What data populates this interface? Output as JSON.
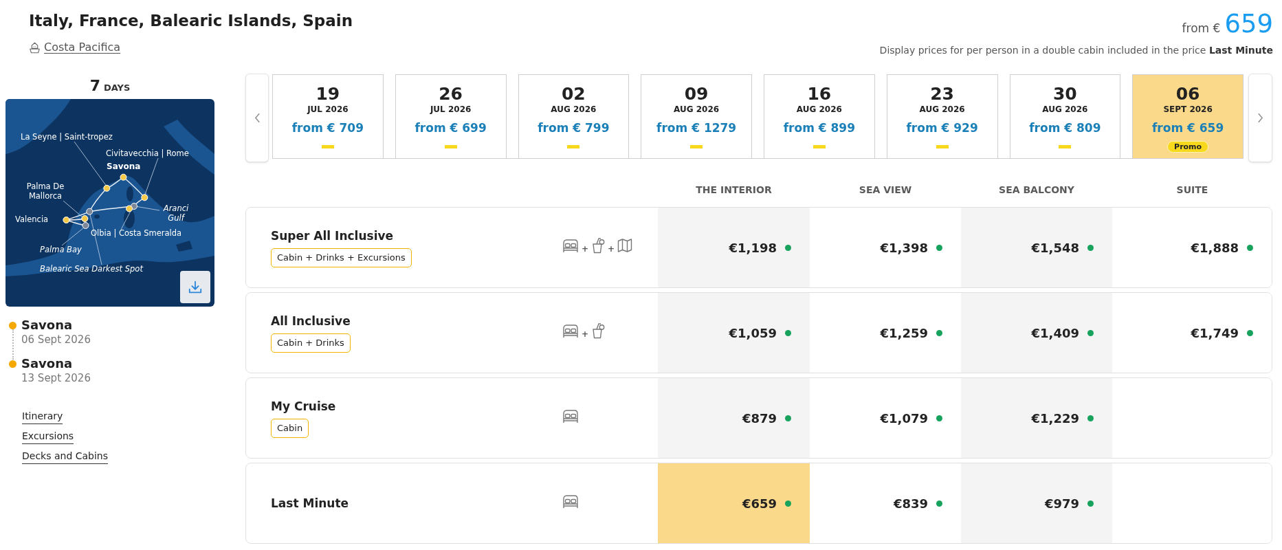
{
  "header": {
    "title": "Italy, France, Balearic Islands, Spain",
    "ship": "Costa Pacifica",
    "price": {
      "prefix": "from €",
      "amount": "659"
    },
    "note": "Display prices for per person in a double cabin included in the price **Last Minute**"
  },
  "duration": {
    "number": "7",
    "unit": "DAYS"
  },
  "map": {
    "labels": [
      {
        "text": "La Seyne | Saint-tropez",
        "kind": "port"
      },
      {
        "text": "Civitavecchia | Rome",
        "kind": "port"
      },
      {
        "text": "Savona",
        "kind": "home"
      },
      {
        "text": "Palma De Mallorca",
        "kind": "port"
      },
      {
        "text": "Valencia",
        "kind": "port"
      },
      {
        "text": "Aranci Gulf",
        "kind": "sea"
      },
      {
        "text": "Olbia | Costa Smeralda",
        "kind": "port"
      },
      {
        "text": "Palma Bay",
        "kind": "sea"
      },
      {
        "text": "Balearic Sea Darkest Spot",
        "kind": "sea"
      }
    ]
  },
  "itinerary": [
    {
      "port": "Savona",
      "date": "06 Sept 2026"
    },
    {
      "port": "Savona",
      "date": "13 Sept 2026"
    }
  ],
  "links": [
    "Itinerary",
    "Excursions",
    "Decks and Cabins"
  ],
  "dates": [
    {
      "day": "19",
      "month": "JUL 2026",
      "price": "from € 709",
      "selected": false
    },
    {
      "day": "26",
      "month": "JUL 2026",
      "price": "from € 699",
      "selected": false
    },
    {
      "day": "02",
      "month": "AUG 2026",
      "price": "from € 799",
      "selected": false
    },
    {
      "day": "09",
      "month": "AUG 2026",
      "price": "from € 1279",
      "selected": false
    },
    {
      "day": "16",
      "month": "AUG 2026",
      "price": "from € 899",
      "selected": false
    },
    {
      "day": "23",
      "month": "AUG 2026",
      "price": "from € 929",
      "selected": false
    },
    {
      "day": "30",
      "month": "AUG 2026",
      "price": "from € 809",
      "selected": false
    },
    {
      "day": "06",
      "month": "SEPT 2026",
      "price": "from € 659",
      "badge": "Promo",
      "selected": true
    }
  ],
  "table": {
    "columns": [
      "THE INTERIOR",
      "SEA VIEW",
      "SEA BALCONY",
      "SUITE"
    ],
    "rows": [
      {
        "name": "Super All Inclusive",
        "tag": "Cabin + Drinks + Excursions",
        "amenities": [
          {
            "kind": "cabin"
          },
          {
            "kind": "drinks",
            "joiner": "+"
          },
          {
            "kind": "excursions",
            "joiner": "+"
          }
        ],
        "prices": [
          {
            "price": "€1,198",
            "available": true,
            "selected": false
          },
          {
            "price": "€1,398",
            "available": true,
            "selected": false
          },
          {
            "price": "€1,548",
            "available": true,
            "selected": false
          },
          {
            "price": "€1,888",
            "available": true,
            "selected": false
          }
        ]
      },
      {
        "name": "All Inclusive",
        "tag": "Cabin + Drinks",
        "amenities": [
          {
            "kind": "cabin"
          },
          {
            "kind": "drinks",
            "joiner": "+"
          }
        ],
        "prices": [
          {
            "price": "€1,059",
            "available": true,
            "selected": false
          },
          {
            "price": "€1,259",
            "available": true,
            "selected": false
          },
          {
            "price": "€1,409",
            "available": true,
            "selected": false
          },
          {
            "price": "€1,749",
            "available": true,
            "selected": false
          }
        ]
      },
      {
        "name": "My Cruise",
        "tag": "Cabin",
        "amenities": [
          {
            "kind": "cabin"
          }
        ],
        "prices": [
          {
            "price": "€879",
            "available": true,
            "selected": false
          },
          {
            "price": "€1,079",
            "available": true,
            "selected": false
          },
          {
            "price": "€1,229",
            "available": true,
            "selected": false
          }
        ]
      },
      {
        "name": "Last Minute",
        "amenities": [
          {
            "kind": "cabin"
          }
        ],
        "prices": [
          {
            "price": "€659",
            "available": true,
            "selected": true
          },
          {
            "price": "€839",
            "available": true,
            "selected": false
          },
          {
            "price": "€979",
            "available": true,
            "selected": false
          }
        ]
      }
    ]
  }
}
